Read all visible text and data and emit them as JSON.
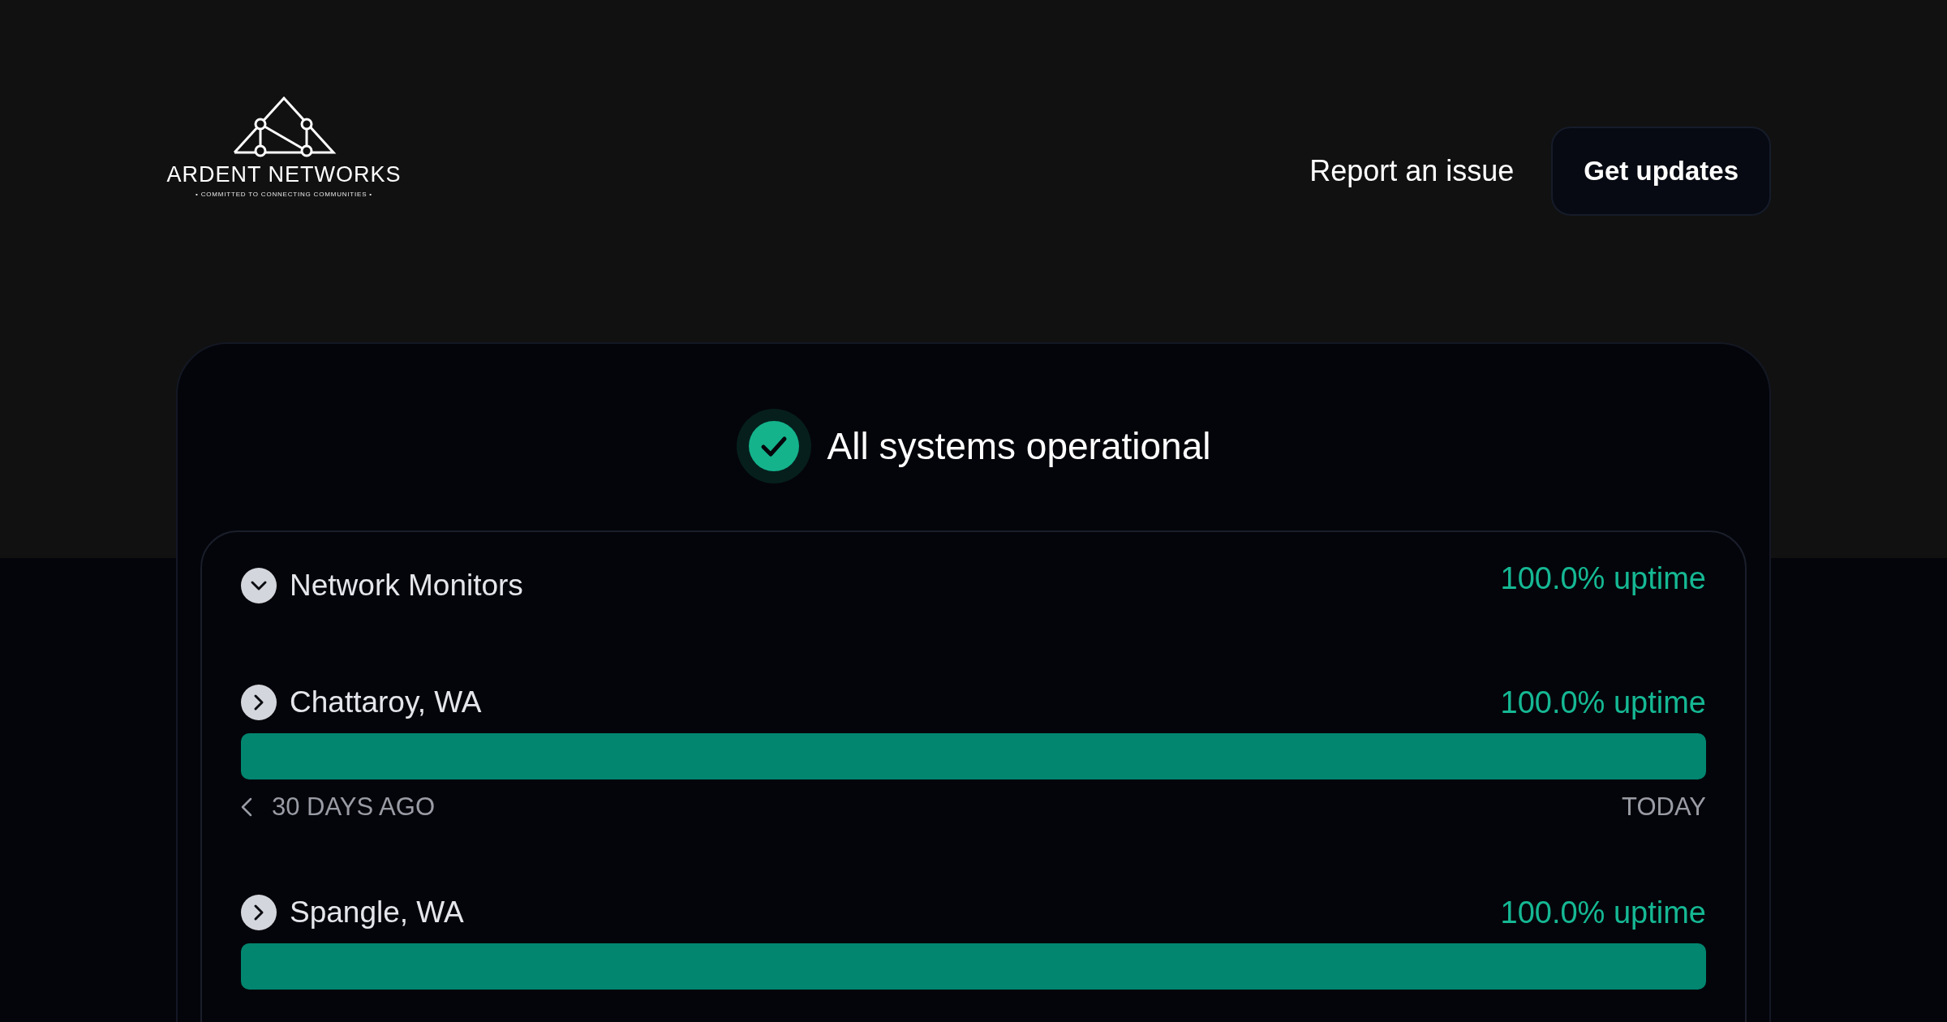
{
  "header": {
    "logo": {
      "name": "ARDENT NETWORKS",
      "tagline": "• COMMITTED TO CONNECTING COMMUNITIES •"
    },
    "report_link": "Report an issue",
    "updates_button": "Get updates"
  },
  "status": {
    "kind": "operational",
    "message": "All systems operational"
  },
  "groups": [
    {
      "name": "Network Monitors",
      "uptime": "100.0% uptime",
      "expanded": true,
      "children": [
        {
          "name": "Chattaroy, WA",
          "uptime": "100.0% uptime",
          "expanded": false,
          "range_start": "30 DAYS AGO",
          "range_end": "TODAY"
        },
        {
          "name": "Spangle, WA",
          "uptime": "100.0% uptime",
          "expanded": false
        }
      ]
    }
  ]
}
